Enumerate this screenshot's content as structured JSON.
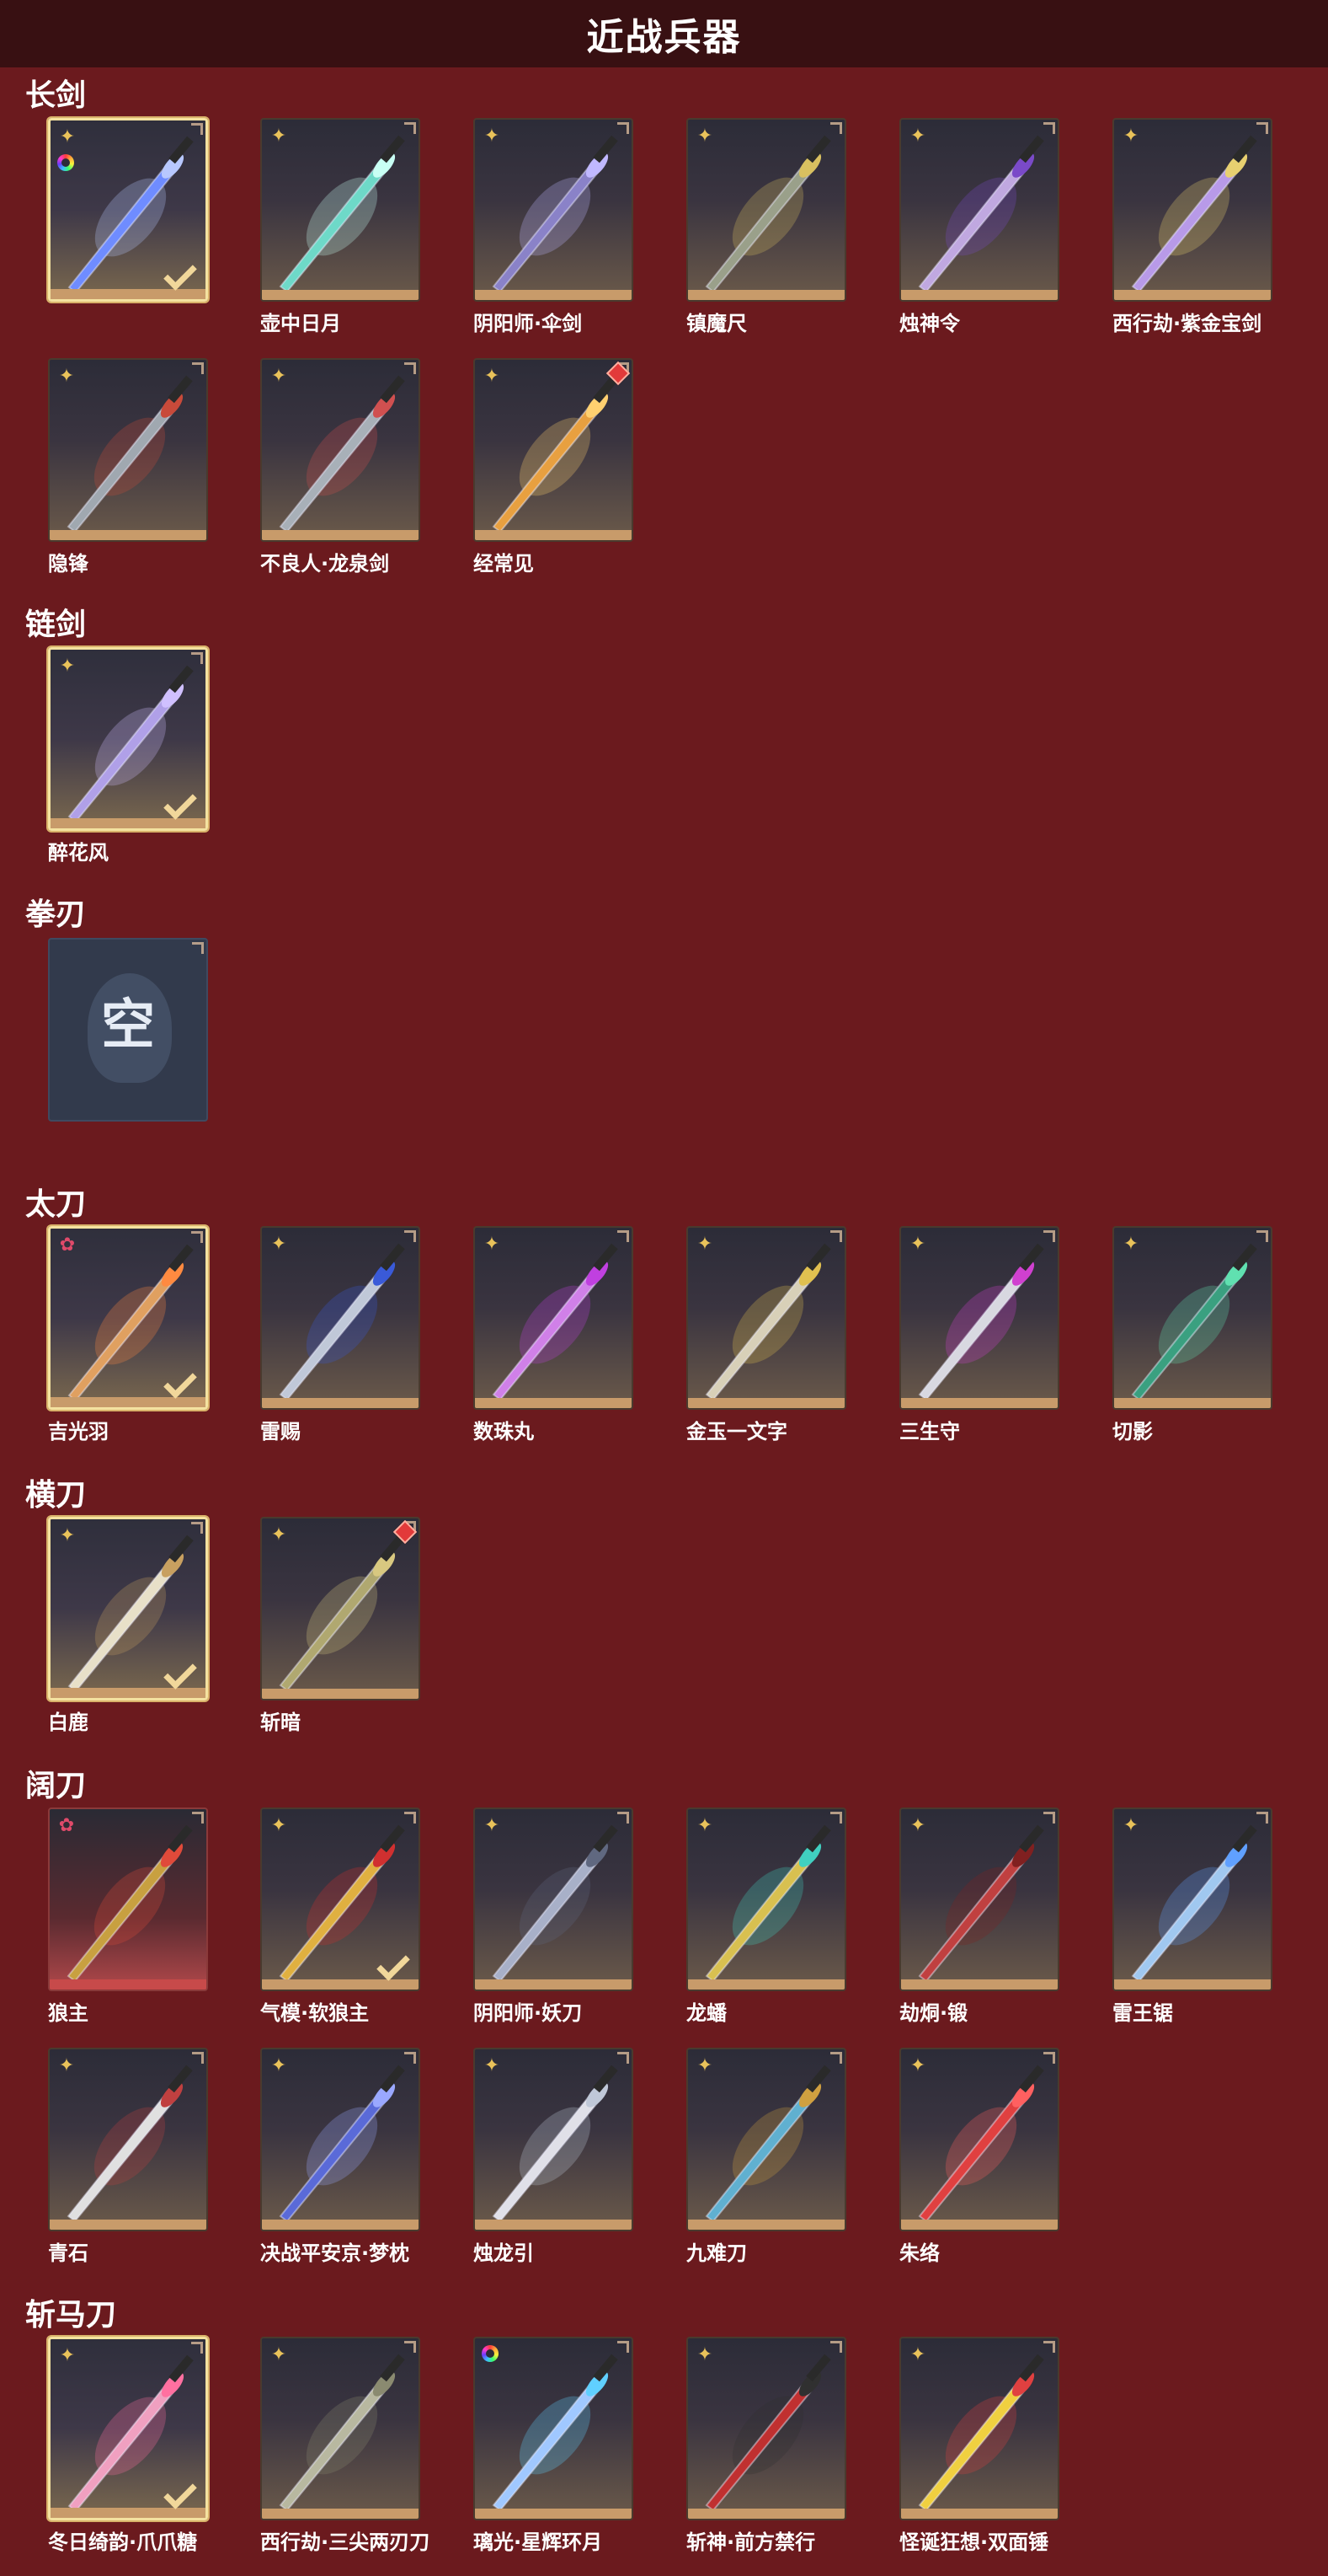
{
  "header": {
    "title": "近战兵器"
  },
  "categories": [
    {
      "name": "长剑",
      "items": [
        {
          "label": "",
          "mark": "star",
          "rainbow": true,
          "selected": true,
          "blade": "#6f8cff",
          "glow": "#b8c8ff"
        },
        {
          "label": "壶中日月",
          "mark": "star",
          "blade": "#6ed9c8",
          "glow": "#c8fff4"
        },
        {
          "label": "阴阳师·伞剑",
          "mark": "star",
          "blade": "#8a82c8",
          "glow": "#c0b8ff"
        },
        {
          "label": "镇魔尺",
          "mark": "star",
          "blade": "#9aa08a",
          "glow": "#d8c060"
        },
        {
          "label": "烛神令",
          "mark": "star",
          "blade": "#c0a8e0",
          "glow": "#7a4ac8"
        },
        {
          "label": "西行劫·紫金宝剑",
          "mark": "star",
          "blade": "#b89ae8",
          "glow": "#e8d070"
        },
        {
          "label": "隐锋",
          "mark": "star",
          "blade": "#a0a8b0",
          "glow": "#c84a3a"
        },
        {
          "label": "不良人·龙泉剑",
          "mark": "star",
          "blade": "#a8b0b8",
          "glow": "#d05050"
        },
        {
          "label": "经常见",
          "mark": "star",
          "redgem": true,
          "blade": "#e8a040",
          "glow": "#ffd070"
        }
      ]
    },
    {
      "name": "链剑",
      "items": [
        {
          "label": "醉花风",
          "mark": "star",
          "selected": true,
          "blade": "#b0a0e8",
          "glow": "#d0c0ff"
        }
      ]
    },
    {
      "name": "拳刃",
      "items": [
        {
          "label": "",
          "empty": true,
          "empty_char": "空"
        }
      ]
    },
    {
      "name": "太刀",
      "items": [
        {
          "label": "吉光羽",
          "mark": "pink",
          "selected": true,
          "blade": "#e0a060",
          "glow": "#ff8a40"
        },
        {
          "label": "雷赐",
          "mark": "star",
          "blade": "#c0c8d8",
          "glow": "#3a5ad8"
        },
        {
          "label": "数珠丸",
          "mark": "star",
          "blade": "#d080e8",
          "glow": "#c040e0"
        },
        {
          "label": "金玉一文字",
          "mark": "star",
          "blade": "#d8d0b8",
          "glow": "#e0c050"
        },
        {
          "label": "三生守",
          "mark": "star",
          "blade": "#d8d8e0",
          "glow": "#d040d0"
        },
        {
          "label": "切影",
          "mark": "star",
          "blade": "#3aa080",
          "glow": "#60e0b0"
        }
      ]
    },
    {
      "name": "横刀",
      "items": [
        {
          "label": "白鹿",
          "mark": "star",
          "selected": true,
          "blade": "#e8e0c8",
          "glow": "#c8a060"
        },
        {
          "label": "斩暗",
          "mark": "star",
          "redgem": true,
          "blade": "#b0a870",
          "glow": "#d8c880"
        }
      ]
    },
    {
      "name": "阔刀",
      "items": [
        {
          "label": "狼主",
          "mark": "pink",
          "red": true,
          "blade": "#c8a040",
          "glow": "#e04a3a"
        },
        {
          "label": "气模·软狼主",
          "mark": "star",
          "selected": false,
          "check": true,
          "blade": "#e0b040",
          "glow": "#d03030"
        },
        {
          "label": "阴阳师·妖刀",
          "mark": "star",
          "blade": "#a8b0c8",
          "glow": "#606880"
        },
        {
          "label": "龙蟠",
          "mark": "star",
          "blade": "#d8c050",
          "glow": "#40d0c0"
        },
        {
          "label": "劫烔·锻",
          "mark": "star",
          "blade": "#c04040",
          "glow": "#802020"
        },
        {
          "label": "雷王锯",
          "mark": "star",
          "blade": "#a0c8f0",
          "glow": "#60a0ff"
        },
        {
          "label": "青石",
          "mark": "star",
          "blade": "#e0e0e0",
          "glow": "#c04040"
        },
        {
          "label": "决战平安京·梦枕",
          "mark": "star",
          "blade": "#5a6ad8",
          "glow": "#9aa8ff"
        },
        {
          "label": "烛龙引",
          "mark": "star",
          "blade": "#e0e0e8",
          "glow": "#c0c8d8"
        },
        {
          "label": "九难刀",
          "mark": "star",
          "blade": "#60b0d0",
          "glow": "#d0a040"
        },
        {
          "label": "朱络",
          "mark": "star",
          "blade": "#e04040",
          "glow": "#ff6060"
        }
      ]
    },
    {
      "name": "斩马刀",
      "items": [
        {
          "label": "冬日绮韵·爪爪糖",
          "mark": "star",
          "selected": true,
          "blade": "#f0a0c0",
          "glow": "#ff70a0"
        },
        {
          "label": "西行劫·三尖两刃刀",
          "mark": "star",
          "blade": "#b8b8a0",
          "glow": "#8a8a70"
        },
        {
          "label": "璃光·星辉环月",
          "mark": "rainbow",
          "blade": "#a0c8ff",
          "glow": "#60d0ff"
        },
        {
          "label": "斩神·前方禁行",
          "mark": "star",
          "blade": "#c03030",
          "glow": "#303030"
        },
        {
          "label": "怪诞狂想·双面锤",
          "mark": "star",
          "blade": "#f0d040",
          "glow": "#e04040"
        }
      ]
    }
  ]
}
